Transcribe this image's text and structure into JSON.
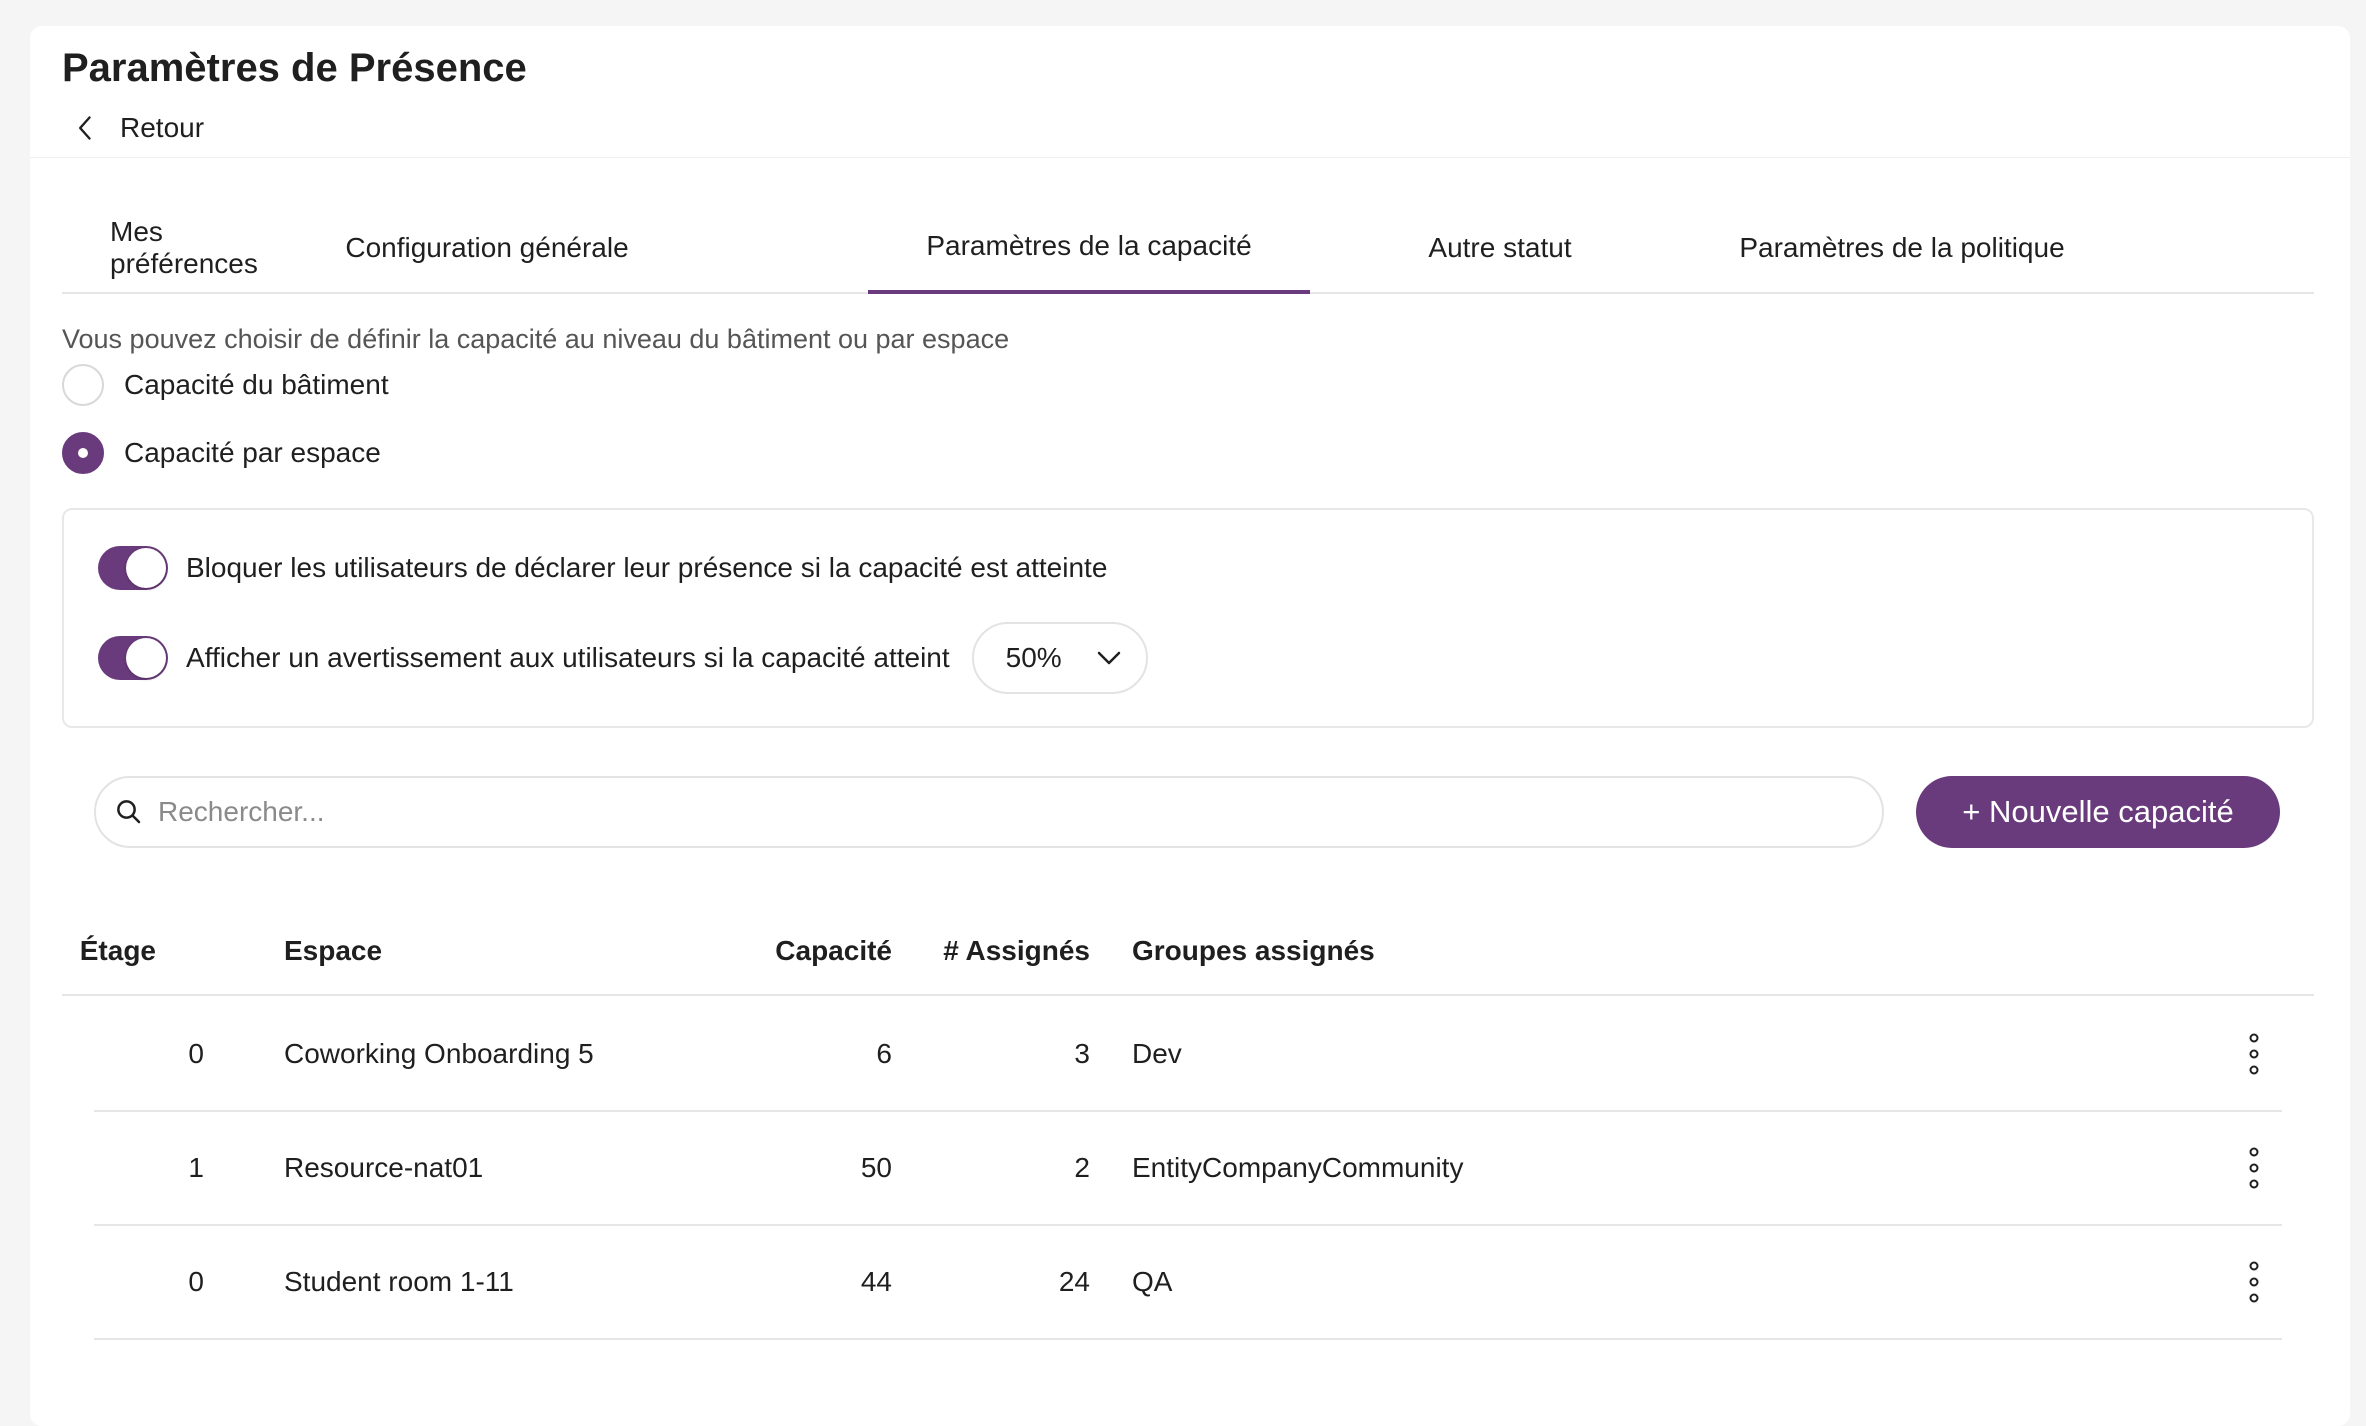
{
  "header": {
    "title": "Paramètres de Présence",
    "back_label": "Retour"
  },
  "tabs": [
    {
      "label": "Mes préférences",
      "active": false
    },
    {
      "label": "Configuration générale",
      "active": false
    },
    {
      "label": "Paramètres de la capacité",
      "active": true
    },
    {
      "label": "Autre statut",
      "active": false
    },
    {
      "label": "Paramètres de la politique",
      "active": false
    }
  ],
  "capacity": {
    "intro": "Vous pouvez choisir de définir la capacité au niveau du bâtiment ou par espace",
    "radio_building": "Capacité du bâtiment",
    "radio_space": "Capacité par espace",
    "selected": "space"
  },
  "options": {
    "block_label": "Bloquer les utilisateurs de déclarer leur présence si la capacité est atteinte",
    "block_enabled": true,
    "warn_label": "Afficher un avertissement aux utilisateurs si la capacité atteint",
    "warn_enabled": true,
    "warn_threshold": "50%"
  },
  "search": {
    "placeholder": "Rechercher..."
  },
  "new_button": "+ Nouvelle capacité",
  "table": {
    "headers": {
      "floor": "Étage",
      "space": "Espace",
      "capacity": "Capacité",
      "assigned": "# Assignés",
      "groups": "Groupes assignés"
    },
    "rows": [
      {
        "floor": "0",
        "space": "Coworking Onboarding 5",
        "capacity": "6",
        "assigned": "3",
        "groups": "Dev"
      },
      {
        "floor": "1",
        "space": "Resource-nat01",
        "capacity": "50",
        "assigned": "2",
        "groups": "EntityCompanyCommunity"
      },
      {
        "floor": "0",
        "space": "Student room 1-11",
        "capacity": "44",
        "assigned": "24",
        "groups": "QA"
      }
    ]
  },
  "colors": {
    "accent": "#6a3b7c"
  }
}
